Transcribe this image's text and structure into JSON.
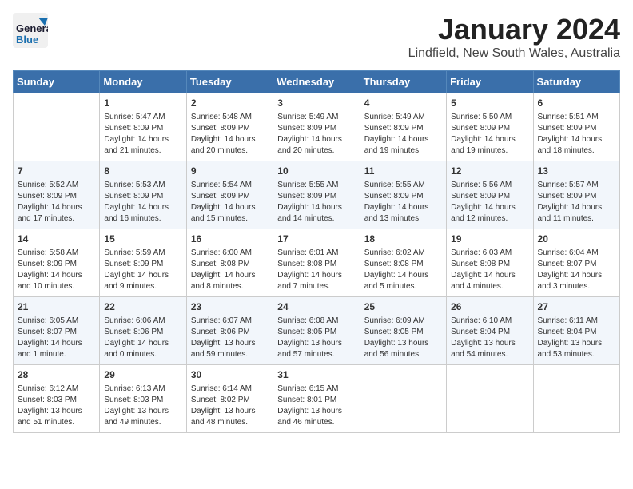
{
  "logo": {
    "line1": "General",
    "line2": "Blue"
  },
  "title": "January 2024",
  "subtitle": "Lindfield, New South Wales, Australia",
  "weekdays": [
    "Sunday",
    "Monday",
    "Tuesday",
    "Wednesday",
    "Thursday",
    "Friday",
    "Saturday"
  ],
  "weeks": [
    [
      {
        "day": "",
        "info": ""
      },
      {
        "day": "1",
        "info": "Sunrise: 5:47 AM\nSunset: 8:09 PM\nDaylight: 14 hours\nand 21 minutes."
      },
      {
        "day": "2",
        "info": "Sunrise: 5:48 AM\nSunset: 8:09 PM\nDaylight: 14 hours\nand 20 minutes."
      },
      {
        "day": "3",
        "info": "Sunrise: 5:49 AM\nSunset: 8:09 PM\nDaylight: 14 hours\nand 20 minutes."
      },
      {
        "day": "4",
        "info": "Sunrise: 5:49 AM\nSunset: 8:09 PM\nDaylight: 14 hours\nand 19 minutes."
      },
      {
        "day": "5",
        "info": "Sunrise: 5:50 AM\nSunset: 8:09 PM\nDaylight: 14 hours\nand 19 minutes."
      },
      {
        "day": "6",
        "info": "Sunrise: 5:51 AM\nSunset: 8:09 PM\nDaylight: 14 hours\nand 18 minutes."
      }
    ],
    [
      {
        "day": "7",
        "info": "Sunrise: 5:52 AM\nSunset: 8:09 PM\nDaylight: 14 hours\nand 17 minutes."
      },
      {
        "day": "8",
        "info": "Sunrise: 5:53 AM\nSunset: 8:09 PM\nDaylight: 14 hours\nand 16 minutes."
      },
      {
        "day": "9",
        "info": "Sunrise: 5:54 AM\nSunset: 8:09 PM\nDaylight: 14 hours\nand 15 minutes."
      },
      {
        "day": "10",
        "info": "Sunrise: 5:55 AM\nSunset: 8:09 PM\nDaylight: 14 hours\nand 14 minutes."
      },
      {
        "day": "11",
        "info": "Sunrise: 5:55 AM\nSunset: 8:09 PM\nDaylight: 14 hours\nand 13 minutes."
      },
      {
        "day": "12",
        "info": "Sunrise: 5:56 AM\nSunset: 8:09 PM\nDaylight: 14 hours\nand 12 minutes."
      },
      {
        "day": "13",
        "info": "Sunrise: 5:57 AM\nSunset: 8:09 PM\nDaylight: 14 hours\nand 11 minutes."
      }
    ],
    [
      {
        "day": "14",
        "info": "Sunrise: 5:58 AM\nSunset: 8:09 PM\nDaylight: 14 hours\nand 10 minutes."
      },
      {
        "day": "15",
        "info": "Sunrise: 5:59 AM\nSunset: 8:09 PM\nDaylight: 14 hours\nand 9 minutes."
      },
      {
        "day": "16",
        "info": "Sunrise: 6:00 AM\nSunset: 8:08 PM\nDaylight: 14 hours\nand 8 minutes."
      },
      {
        "day": "17",
        "info": "Sunrise: 6:01 AM\nSunset: 8:08 PM\nDaylight: 14 hours\nand 7 minutes."
      },
      {
        "day": "18",
        "info": "Sunrise: 6:02 AM\nSunset: 8:08 PM\nDaylight: 14 hours\nand 5 minutes."
      },
      {
        "day": "19",
        "info": "Sunrise: 6:03 AM\nSunset: 8:08 PM\nDaylight: 14 hours\nand 4 minutes."
      },
      {
        "day": "20",
        "info": "Sunrise: 6:04 AM\nSunset: 8:07 PM\nDaylight: 14 hours\nand 3 minutes."
      }
    ],
    [
      {
        "day": "21",
        "info": "Sunrise: 6:05 AM\nSunset: 8:07 PM\nDaylight: 14 hours\nand 1 minute."
      },
      {
        "day": "22",
        "info": "Sunrise: 6:06 AM\nSunset: 8:06 PM\nDaylight: 14 hours\nand 0 minutes."
      },
      {
        "day": "23",
        "info": "Sunrise: 6:07 AM\nSunset: 8:06 PM\nDaylight: 13 hours\nand 59 minutes."
      },
      {
        "day": "24",
        "info": "Sunrise: 6:08 AM\nSunset: 8:05 PM\nDaylight: 13 hours\nand 57 minutes."
      },
      {
        "day": "25",
        "info": "Sunrise: 6:09 AM\nSunset: 8:05 PM\nDaylight: 13 hours\nand 56 minutes."
      },
      {
        "day": "26",
        "info": "Sunrise: 6:10 AM\nSunset: 8:04 PM\nDaylight: 13 hours\nand 54 minutes."
      },
      {
        "day": "27",
        "info": "Sunrise: 6:11 AM\nSunset: 8:04 PM\nDaylight: 13 hours\nand 53 minutes."
      }
    ],
    [
      {
        "day": "28",
        "info": "Sunrise: 6:12 AM\nSunset: 8:03 PM\nDaylight: 13 hours\nand 51 minutes."
      },
      {
        "day": "29",
        "info": "Sunrise: 6:13 AM\nSunset: 8:03 PM\nDaylight: 13 hours\nand 49 minutes."
      },
      {
        "day": "30",
        "info": "Sunrise: 6:14 AM\nSunset: 8:02 PM\nDaylight: 13 hours\nand 48 minutes."
      },
      {
        "day": "31",
        "info": "Sunrise: 6:15 AM\nSunset: 8:01 PM\nDaylight: 13 hours\nand 46 minutes."
      },
      {
        "day": "",
        "info": ""
      },
      {
        "day": "",
        "info": ""
      },
      {
        "day": "",
        "info": ""
      }
    ]
  ]
}
